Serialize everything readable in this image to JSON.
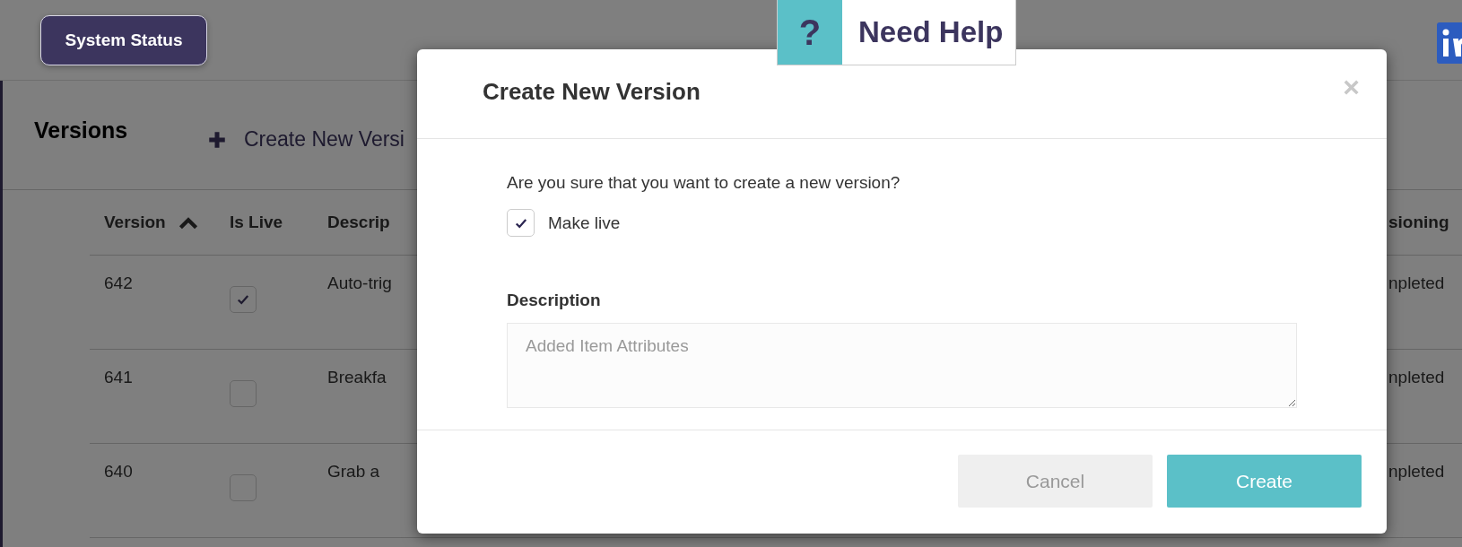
{
  "header": {
    "status_button": "System Status",
    "help": {
      "icon": "?",
      "label": "Need Help"
    }
  },
  "versions": {
    "title": "Versions",
    "create_link": "Create New Versi",
    "columns": [
      {
        "label": "Version",
        "sorted": true
      },
      {
        "label": "Is Live"
      },
      {
        "label": "Descrip"
      },
      {
        "label": "sioning"
      }
    ],
    "rows": [
      {
        "version": "642",
        "is_live": true,
        "description": "Auto-trig",
        "column_4": "npleted"
      },
      {
        "version": "641",
        "is_live": false,
        "description": "Breakfa",
        "column_4": "npleted"
      },
      {
        "version": "640",
        "is_live": false,
        "description": "Grab a",
        "column_4": "npleted"
      }
    ]
  },
  "dialog": {
    "title": "Create New Version",
    "close": "×",
    "question": "Are you sure that you want to create a new version?",
    "make_live": {
      "label": "Make live",
      "checked": true
    },
    "description": {
      "label": "Description",
      "placeholder": "Added Item Attributes"
    },
    "buttons": [
      {
        "label": "Cancel",
        "kind": "secondary"
      },
      {
        "label": "Create",
        "kind": "primary"
      }
    ]
  }
}
